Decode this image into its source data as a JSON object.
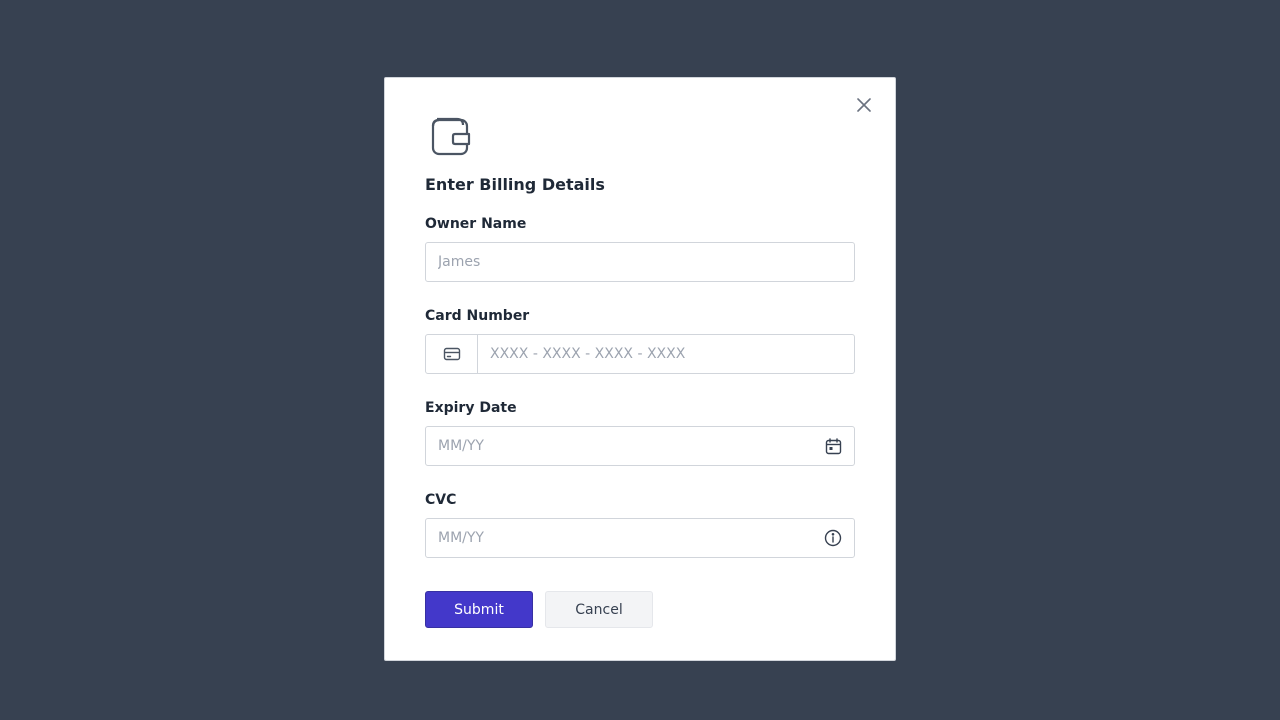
{
  "modal": {
    "title": "Enter Billing Details",
    "header_icon": "wallet-icon",
    "close_icon": "close-icon"
  },
  "fields": {
    "owner_name": {
      "label": "Owner Name",
      "placeholder": "James",
      "value": ""
    },
    "card_number": {
      "label": "Card Number",
      "placeholder": "XXXX - XXXX - XXXX - XXXX",
      "value": "",
      "icon": "credit-card-icon"
    },
    "expiry_date": {
      "label": "Expiry Date",
      "placeholder": "MM/YY",
      "value": "",
      "icon": "calendar-icon"
    },
    "cvc": {
      "label": "CVC",
      "placeholder": "MM/YY",
      "value": "",
      "icon": "info-icon"
    }
  },
  "actions": {
    "submit_label": "Submit",
    "cancel_label": "Cancel"
  },
  "colors": {
    "backdrop": "#374151",
    "primary": "#4338ca",
    "secondary_bg": "#f3f4f6"
  }
}
